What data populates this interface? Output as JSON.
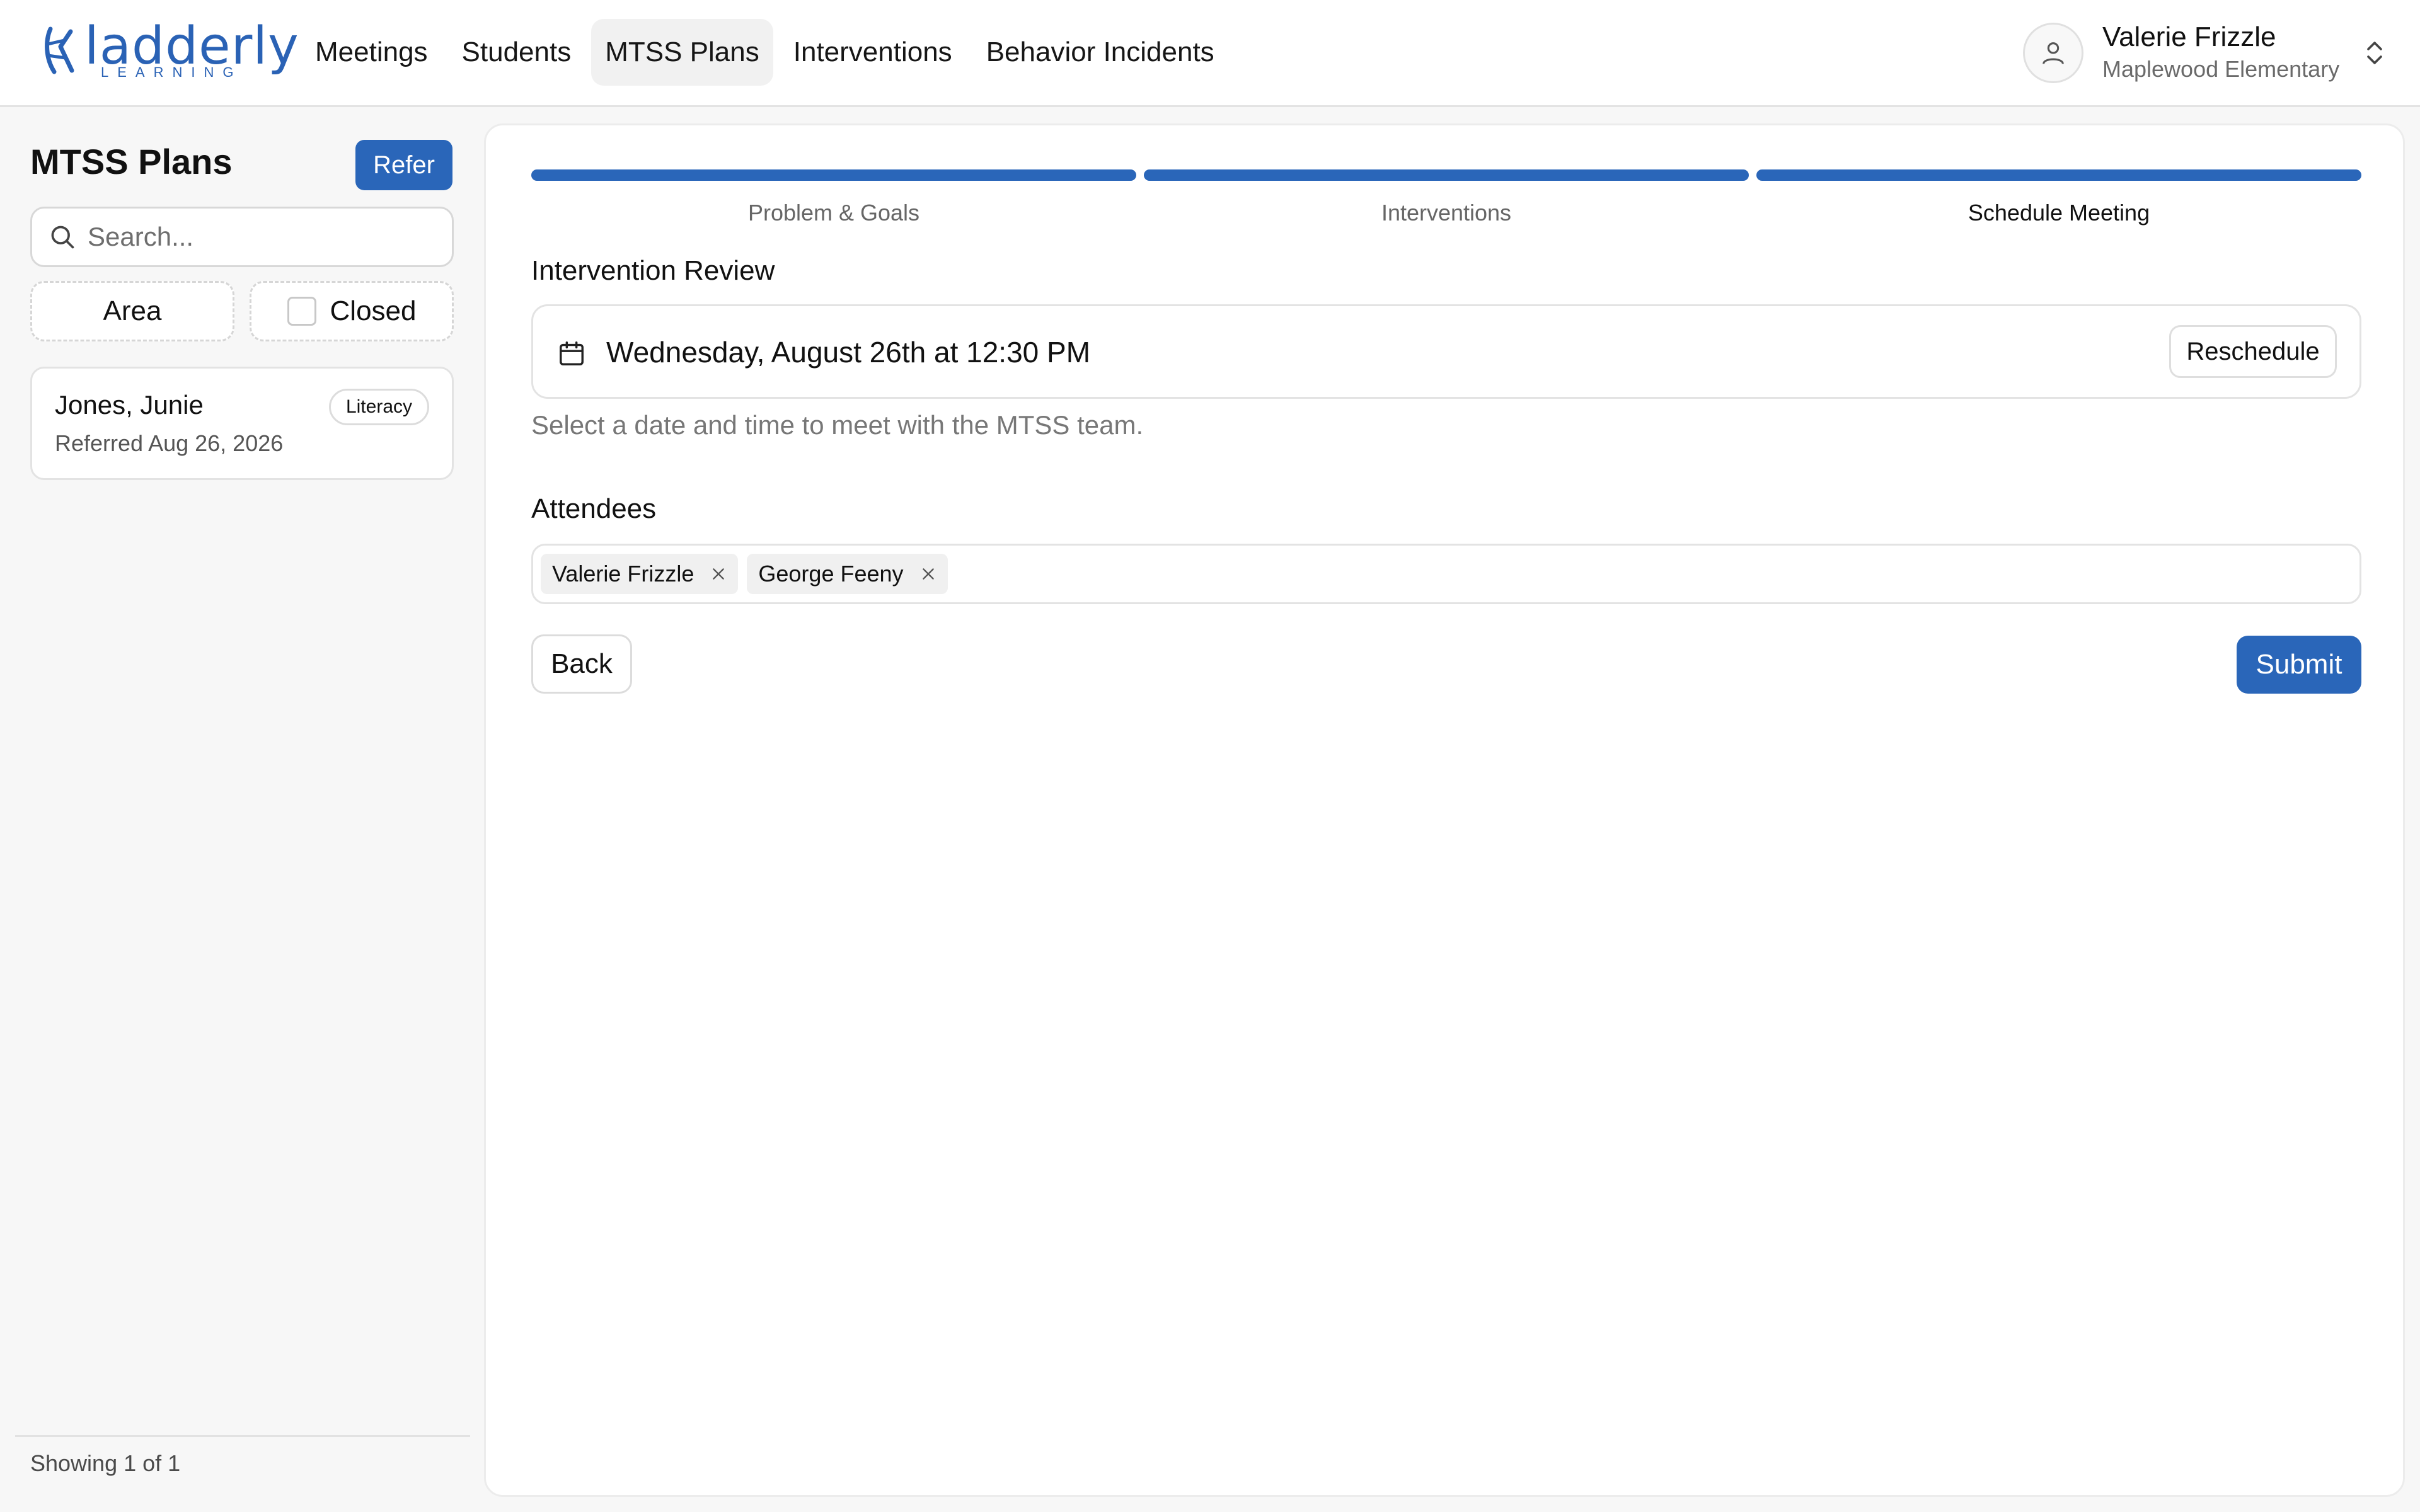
{
  "brand": {
    "name": "ladderly",
    "tagline": "LEARNING",
    "color": "#2a62b5"
  },
  "nav": {
    "items": [
      {
        "label": "Meetings",
        "active": false
      },
      {
        "label": "Students",
        "active": false
      },
      {
        "label": "MTSS Plans",
        "active": true
      },
      {
        "label": "Interventions",
        "active": false
      },
      {
        "label": "Behavior Incidents",
        "active": false
      }
    ]
  },
  "user": {
    "name": "Valerie Frizzle",
    "school": "Maplewood Elementary",
    "icon": "user-icon"
  },
  "sidebar": {
    "title": "MTSS Plans",
    "refer_label": "Refer",
    "search_placeholder": "Search...",
    "filters": {
      "area_label": "Area",
      "closed_label": "Closed",
      "closed_checked": false
    },
    "plans": [
      {
        "name": "Jones, Junie",
        "referred": "Referred Aug 26, 2026",
        "area": "Literacy"
      }
    ],
    "footer": "Showing 1 of 1"
  },
  "wizard": {
    "steps": [
      {
        "label": "Problem & Goals",
        "complete": true
      },
      {
        "label": "Interventions",
        "complete": true
      },
      {
        "label": "Schedule Meeting",
        "complete": true,
        "current": true
      }
    ],
    "meeting": {
      "section_label": "Intervention Review",
      "datetime": "Wednesday, August 26th at 12:30 PM",
      "reschedule_label": "Reschedule",
      "helper": "Select a date and time to meet with the MTSS team."
    },
    "attendees": {
      "label": "Attendees",
      "list": [
        "Valerie Frizzle",
        "George Feeny"
      ]
    },
    "back_label": "Back",
    "submit_label": "Submit"
  },
  "colors": {
    "accent": "#2a66b9",
    "muted_text": "#777777"
  }
}
